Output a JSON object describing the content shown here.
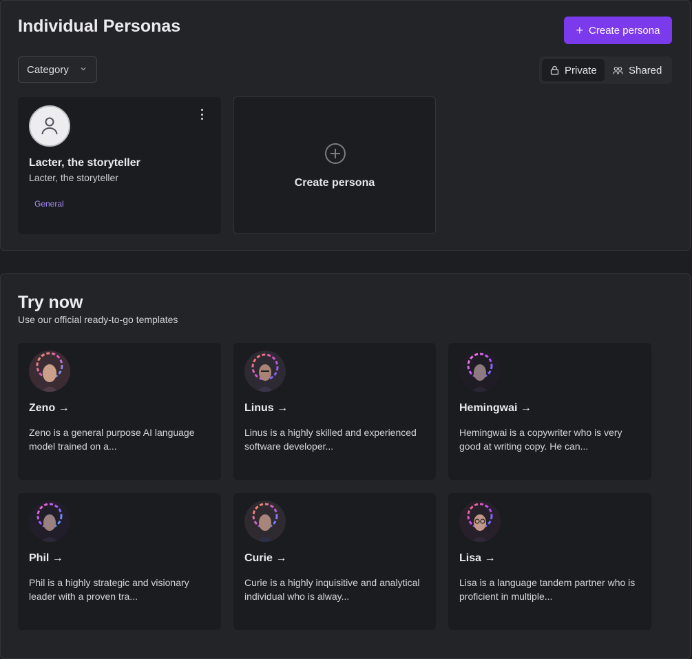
{
  "header": {
    "title": "Individual Personas",
    "create_button": "Create persona",
    "category_label": "Category",
    "toggle": {
      "private": "Private",
      "shared": "Shared",
      "active": "Private"
    }
  },
  "personas": [
    {
      "name": "Lacter, the storyteller",
      "subtitle": "Lacter, the storyteller",
      "tag": "General"
    }
  ],
  "create_card": {
    "label": "Create persona"
  },
  "try_now": {
    "title": "Try now",
    "subtitle": "Use our official ready-to-go templates",
    "templates": [
      {
        "name": "Zeno →",
        "description": "Zeno is a general purpose AI language model trained on a..."
      },
      {
        "name": "Linus →",
        "description": "Linus is a highly skilled and experienced software developer..."
      },
      {
        "name": "Hemingwai →",
        "description": "Hemingwai is a copywriter who is very good at writing copy. He can..."
      },
      {
        "name": "Phil →",
        "description": "Phil is a highly strategic and visionary leader with a proven tra..."
      },
      {
        "name": "Curie →",
        "description": "Curie is a highly inquisitive and analytical individual who is alway..."
      },
      {
        "name": "Lisa →",
        "description": "Lisa is a language tandem partner who is proficient in multiple..."
      }
    ]
  },
  "colors": {
    "accent": "#7c3aed",
    "tag": "#a78bfa",
    "background": "#1d1e21",
    "card": "#1b1c1f"
  }
}
